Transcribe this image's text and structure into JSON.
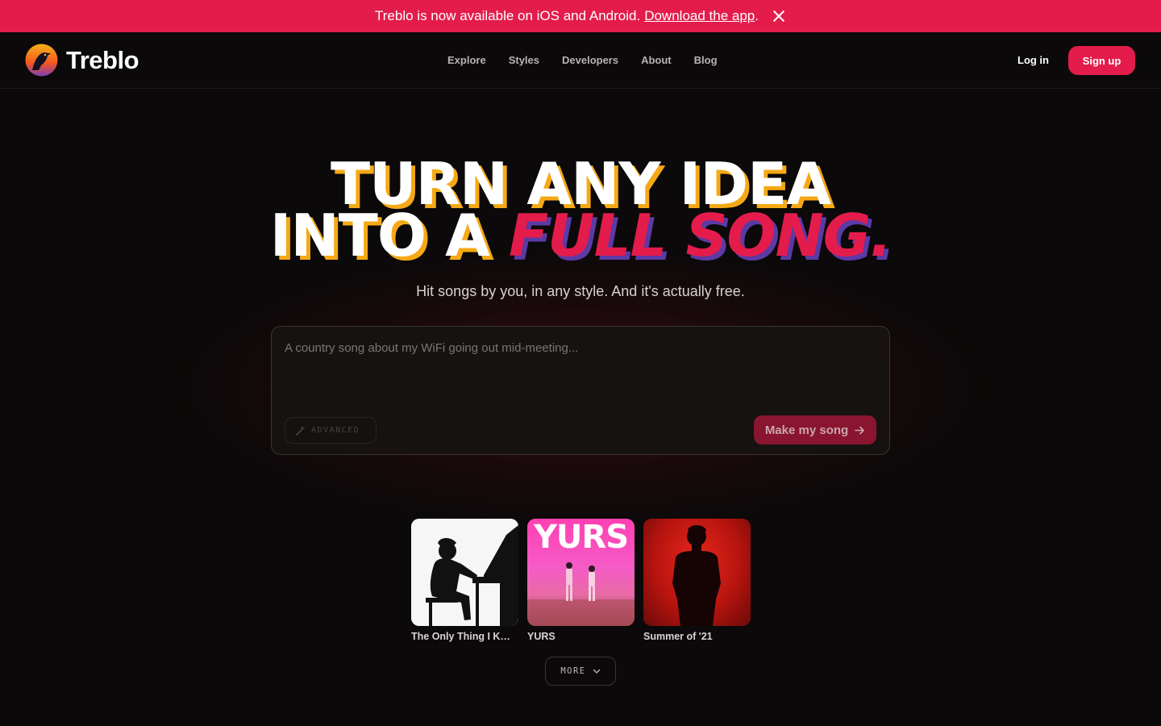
{
  "banner": {
    "text": "Treblo is now available on iOS and Android.",
    "link": "Download the app",
    "suffix": "."
  },
  "header": {
    "brand": "Treblo",
    "nav": [
      "Explore",
      "Styles",
      "Developers",
      "About",
      "Blog"
    ],
    "login": "Log in",
    "signup": "Sign up"
  },
  "hero": {
    "line1": "TURN ANY IDEA",
    "line2_plain": "INTO A",
    "line2_accent": "FULL SONG.",
    "subtitle": "Hit songs by you, in any style. And it's actually free."
  },
  "prompt": {
    "placeholder": "A country song about my WiFi going out mid-meeting...",
    "value": "",
    "advanced_label": "ADVANCED",
    "submit_label": "Make my song"
  },
  "songs": [
    {
      "title": "The Only Thing I Kn...",
      "cover": "piano-silhouette"
    },
    {
      "title": "YURS",
      "cover_text": "YURS"
    },
    {
      "title": "Summer of '21",
      "cover": "red-silhouette"
    }
  ],
  "more_label": "MORE",
  "colors": {
    "brand": "#e31c4b",
    "accent_yellow": "#f5a916",
    "accent_purple": "#5b3aa6",
    "background": "#0b0909"
  },
  "icons": [
    "close-icon",
    "wand-icon",
    "arrow-right-icon",
    "chevron-down-icon"
  ]
}
